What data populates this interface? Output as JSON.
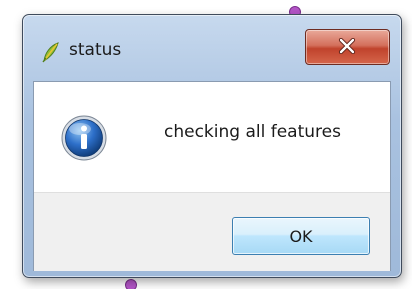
{
  "window": {
    "title": "status",
    "app_icon": "qgis-logo-icon",
    "close_icon": "close-icon",
    "close_button_color": "#c7503a"
  },
  "message": {
    "icon": "info-icon",
    "text": "checking all features"
  },
  "buttons": {
    "ok_label": "OK"
  },
  "colors": {
    "titlebar": "#b4cbe6",
    "ok_button": "#bee6fd",
    "background_marker": "#b455c8"
  }
}
